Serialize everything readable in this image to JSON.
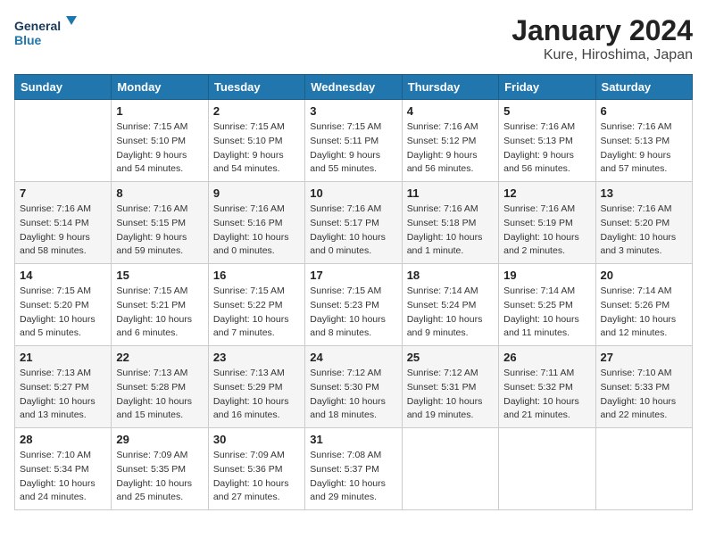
{
  "header": {
    "logo_general": "General",
    "logo_blue": "Blue",
    "title": "January 2024",
    "subtitle": "Kure, Hiroshima, Japan"
  },
  "columns": [
    "Sunday",
    "Monday",
    "Tuesday",
    "Wednesday",
    "Thursday",
    "Friday",
    "Saturday"
  ],
  "weeks": [
    [
      {
        "day": "",
        "sunrise": "",
        "sunset": "",
        "daylight": ""
      },
      {
        "day": "1",
        "sunrise": "Sunrise: 7:15 AM",
        "sunset": "Sunset: 5:10 PM",
        "daylight": "Daylight: 9 hours and 54 minutes."
      },
      {
        "day": "2",
        "sunrise": "Sunrise: 7:15 AM",
        "sunset": "Sunset: 5:10 PM",
        "daylight": "Daylight: 9 hours and 54 minutes."
      },
      {
        "day": "3",
        "sunrise": "Sunrise: 7:15 AM",
        "sunset": "Sunset: 5:11 PM",
        "daylight": "Daylight: 9 hours and 55 minutes."
      },
      {
        "day": "4",
        "sunrise": "Sunrise: 7:16 AM",
        "sunset": "Sunset: 5:12 PM",
        "daylight": "Daylight: 9 hours and 56 minutes."
      },
      {
        "day": "5",
        "sunrise": "Sunrise: 7:16 AM",
        "sunset": "Sunset: 5:13 PM",
        "daylight": "Daylight: 9 hours and 56 minutes."
      },
      {
        "day": "6",
        "sunrise": "Sunrise: 7:16 AM",
        "sunset": "Sunset: 5:13 PM",
        "daylight": "Daylight: 9 hours and 57 minutes."
      }
    ],
    [
      {
        "day": "7",
        "sunrise": "Sunrise: 7:16 AM",
        "sunset": "Sunset: 5:14 PM",
        "daylight": "Daylight: 9 hours and 58 minutes."
      },
      {
        "day": "8",
        "sunrise": "Sunrise: 7:16 AM",
        "sunset": "Sunset: 5:15 PM",
        "daylight": "Daylight: 9 hours and 59 minutes."
      },
      {
        "day": "9",
        "sunrise": "Sunrise: 7:16 AM",
        "sunset": "Sunset: 5:16 PM",
        "daylight": "Daylight: 10 hours and 0 minutes."
      },
      {
        "day": "10",
        "sunrise": "Sunrise: 7:16 AM",
        "sunset": "Sunset: 5:17 PM",
        "daylight": "Daylight: 10 hours and 0 minutes."
      },
      {
        "day": "11",
        "sunrise": "Sunrise: 7:16 AM",
        "sunset": "Sunset: 5:18 PM",
        "daylight": "Daylight: 10 hours and 1 minute."
      },
      {
        "day": "12",
        "sunrise": "Sunrise: 7:16 AM",
        "sunset": "Sunset: 5:19 PM",
        "daylight": "Daylight: 10 hours and 2 minutes."
      },
      {
        "day": "13",
        "sunrise": "Sunrise: 7:16 AM",
        "sunset": "Sunset: 5:20 PM",
        "daylight": "Daylight: 10 hours and 3 minutes."
      }
    ],
    [
      {
        "day": "14",
        "sunrise": "Sunrise: 7:15 AM",
        "sunset": "Sunset: 5:20 PM",
        "daylight": "Daylight: 10 hours and 5 minutes."
      },
      {
        "day": "15",
        "sunrise": "Sunrise: 7:15 AM",
        "sunset": "Sunset: 5:21 PM",
        "daylight": "Daylight: 10 hours and 6 minutes."
      },
      {
        "day": "16",
        "sunrise": "Sunrise: 7:15 AM",
        "sunset": "Sunset: 5:22 PM",
        "daylight": "Daylight: 10 hours and 7 minutes."
      },
      {
        "day": "17",
        "sunrise": "Sunrise: 7:15 AM",
        "sunset": "Sunset: 5:23 PM",
        "daylight": "Daylight: 10 hours and 8 minutes."
      },
      {
        "day": "18",
        "sunrise": "Sunrise: 7:14 AM",
        "sunset": "Sunset: 5:24 PM",
        "daylight": "Daylight: 10 hours and 9 minutes."
      },
      {
        "day": "19",
        "sunrise": "Sunrise: 7:14 AM",
        "sunset": "Sunset: 5:25 PM",
        "daylight": "Daylight: 10 hours and 11 minutes."
      },
      {
        "day": "20",
        "sunrise": "Sunrise: 7:14 AM",
        "sunset": "Sunset: 5:26 PM",
        "daylight": "Daylight: 10 hours and 12 minutes."
      }
    ],
    [
      {
        "day": "21",
        "sunrise": "Sunrise: 7:13 AM",
        "sunset": "Sunset: 5:27 PM",
        "daylight": "Daylight: 10 hours and 13 minutes."
      },
      {
        "day": "22",
        "sunrise": "Sunrise: 7:13 AM",
        "sunset": "Sunset: 5:28 PM",
        "daylight": "Daylight: 10 hours and 15 minutes."
      },
      {
        "day": "23",
        "sunrise": "Sunrise: 7:13 AM",
        "sunset": "Sunset: 5:29 PM",
        "daylight": "Daylight: 10 hours and 16 minutes."
      },
      {
        "day": "24",
        "sunrise": "Sunrise: 7:12 AM",
        "sunset": "Sunset: 5:30 PM",
        "daylight": "Daylight: 10 hours and 18 minutes."
      },
      {
        "day": "25",
        "sunrise": "Sunrise: 7:12 AM",
        "sunset": "Sunset: 5:31 PM",
        "daylight": "Daylight: 10 hours and 19 minutes."
      },
      {
        "day": "26",
        "sunrise": "Sunrise: 7:11 AM",
        "sunset": "Sunset: 5:32 PM",
        "daylight": "Daylight: 10 hours and 21 minutes."
      },
      {
        "day": "27",
        "sunrise": "Sunrise: 7:10 AM",
        "sunset": "Sunset: 5:33 PM",
        "daylight": "Daylight: 10 hours and 22 minutes."
      }
    ],
    [
      {
        "day": "28",
        "sunrise": "Sunrise: 7:10 AM",
        "sunset": "Sunset: 5:34 PM",
        "daylight": "Daylight: 10 hours and 24 minutes."
      },
      {
        "day": "29",
        "sunrise": "Sunrise: 7:09 AM",
        "sunset": "Sunset: 5:35 PM",
        "daylight": "Daylight: 10 hours and 25 minutes."
      },
      {
        "day": "30",
        "sunrise": "Sunrise: 7:09 AM",
        "sunset": "Sunset: 5:36 PM",
        "daylight": "Daylight: 10 hours and 27 minutes."
      },
      {
        "day": "31",
        "sunrise": "Sunrise: 7:08 AM",
        "sunset": "Sunset: 5:37 PM",
        "daylight": "Daylight: 10 hours and 29 minutes."
      },
      {
        "day": "",
        "sunrise": "",
        "sunset": "",
        "daylight": ""
      },
      {
        "day": "",
        "sunrise": "",
        "sunset": "",
        "daylight": ""
      },
      {
        "day": "",
        "sunrise": "",
        "sunset": "",
        "daylight": ""
      }
    ]
  ]
}
